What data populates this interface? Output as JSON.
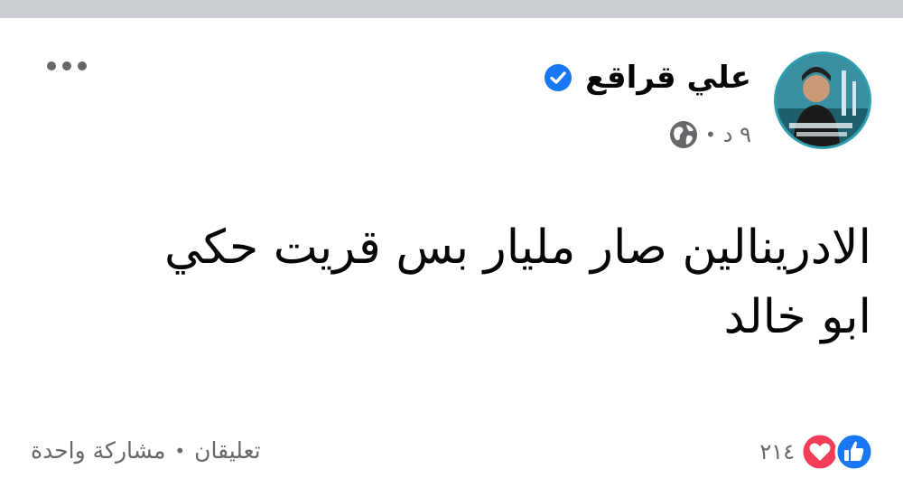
{
  "post": {
    "author": "علي قراقع",
    "time": "٩ د",
    "separator": "•",
    "text": "الادرينالين صار مليار بس قريت حكي\nابو خالد",
    "reactions_count": "٢١٤",
    "comments": "تعليقان",
    "shares": "مشاركة واحدة",
    "stats_separator": "•"
  },
  "icons": {
    "more": "more-options-icon",
    "verified": "verified-badge-icon",
    "privacy": "globe-icon",
    "like": "like-reaction-icon",
    "love": "love-reaction-icon"
  },
  "colors": {
    "verified_blue": "#1877f2",
    "love_red": "#f33e58",
    "secondary_text": "#65676b",
    "top_bar": "#c9ccd1"
  }
}
